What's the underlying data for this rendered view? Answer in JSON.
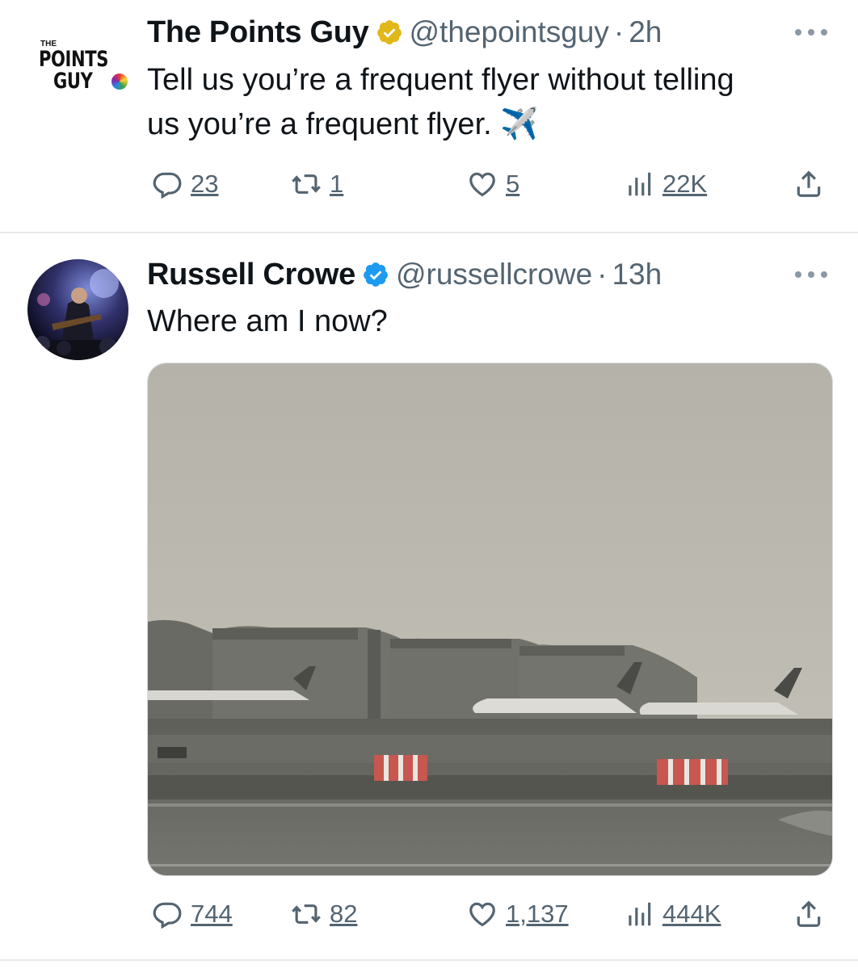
{
  "tweets": [
    {
      "author": {
        "name": "The Points Guy",
        "handle": "@thepointsguy",
        "time": "2h",
        "verified": "gold",
        "logo_text_small": "THE",
        "logo_text_line1": "POINTS",
        "logo_text_line2": "GUY"
      },
      "text_line1": "Tell us you’re a frequent flyer without telling",
      "text_line2": "us you’re a frequent flyer. ✈️",
      "actions": {
        "replies": "23",
        "reposts": "1",
        "likes": "5",
        "views": "22K"
      }
    },
    {
      "author": {
        "name": "Russell Crowe",
        "handle": "@russellcrowe",
        "time": "13h",
        "verified": "blue"
      },
      "text_line1": "Where am I now?",
      "media": {
        "icon": "airport-photo"
      },
      "actions": {
        "replies": "744",
        "reposts": "82",
        "likes": "1,137",
        "views": "444K"
      }
    }
  ],
  "separator_dot": "·",
  "colors": {
    "gold_badge": "#e2b719",
    "blue_badge": "#1d9bf0",
    "muted": "#536471"
  }
}
